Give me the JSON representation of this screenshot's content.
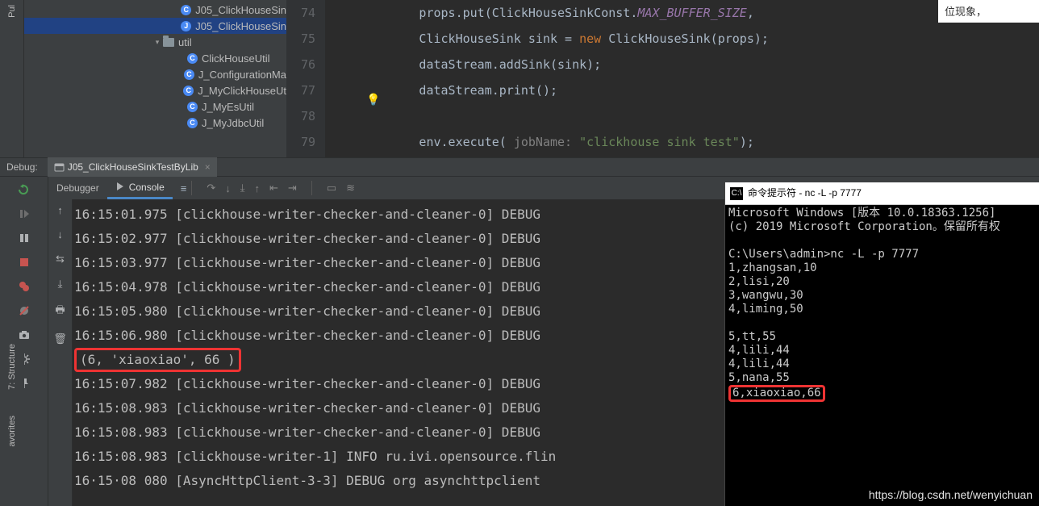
{
  "leftbar": {
    "v1": "Pul"
  },
  "project": {
    "items": [
      {
        "indent": 190,
        "cls": "c",
        "letter": "C",
        "label": "J05_ClickHouseSin",
        "sel": false
      },
      {
        "indent": 190,
        "cls": "j",
        "letter": "J",
        "label": "J05_ClickHouseSin",
        "sel": true
      },
      {
        "indent": 160,
        "folder": true,
        "chev": true,
        "label": "util",
        "sel": false
      },
      {
        "indent": 190,
        "cls": "c",
        "letter": "C",
        "label": "ClickHouseUtil",
        "sel": false
      },
      {
        "indent": 190,
        "cls": "c",
        "letter": "C",
        "label": "J_ConfigurationMa",
        "sel": false
      },
      {
        "indent": 190,
        "cls": "c",
        "letter": "C",
        "label": "J_MyClickHouseUt",
        "sel": false
      },
      {
        "indent": 190,
        "cls": "c",
        "letter": "C",
        "label": "J_MyEsUtil",
        "sel": false
      },
      {
        "indent": 190,
        "cls": "c",
        "letter": "C",
        "label": "J_MyJdbcUtil",
        "sel": false
      }
    ]
  },
  "editor": {
    "lines": [
      {
        "n": "74",
        "html": "props.put(ClickHouseSinkConst.<span class='fld'>MAX_BUFFER_SIZE</span>,"
      },
      {
        "n": "75",
        "html": "ClickHouseSink sink = <span class='kw'>new</span> ClickHouseSink(props);"
      },
      {
        "n": "76",
        "html": "dataStream.addSink(sink);"
      },
      {
        "n": "77",
        "html": "dataStream.print();"
      },
      {
        "n": "78",
        "html": ""
      },
      {
        "n": "79",
        "html": "env.execute( <span class='prm'>jobName:</span> <span class='str'>\"clickhouse sink test\"</span>);"
      }
    ]
  },
  "debug": {
    "label": "Debug:",
    "tab": "J05_ClickHouseSinkTestByLib"
  },
  "tabs": {
    "debugger": "Debugger",
    "console": "Console"
  },
  "consoleLines": [
    "16:15:01.975 [clickhouse-writer-checker-and-cleaner-0] DEBUG ",
    "16:15:02.977 [clickhouse-writer-checker-and-cleaner-0] DEBUG ",
    "16:15:03.977 [clickhouse-writer-checker-and-cleaner-0] DEBUG ",
    "16:15:04.978 [clickhouse-writer-checker-and-cleaner-0] DEBUG ",
    "16:15:05.980 [clickhouse-writer-checker-and-cleaner-0] DEBUG ",
    "16:15:06.980 [clickhouse-writer-checker-and-cleaner-0] DEBUG "
  ],
  "consoleHi": "(6, 'xiaoxiao', 66 )",
  "consoleLines2": [
    "16:15:07.982 [clickhouse-writer-checker-and-cleaner-0] DEBUG ",
    "16:15:08.983 [clickhouse-writer-checker-and-cleaner-0] DEBUG ",
    "16:15:08.983 [clickhouse-writer-checker-and-cleaner-0] DEBUG ",
    "16:15:08.983 [clickhouse-writer-1] INFO ru.ivi.opensource.flin",
    "16·15·08 080 [AsyncHttpClient-3-3] DEBUG org asynchttpclient "
  ],
  "cmd": {
    "title": "命令提示符 - nc  -L  -p  7777",
    "body1": "Microsoft Windows [版本 10.0.18363.1256]\n(c) 2019 Microsoft Corporation。保留所有权\n\nC:\\Users\\admin>nc -L -p 7777\n1,zhangsan,10\n2,lisi,20\n3,wangwu,30\n4,liming,50\n\n5,tt,55\n4,lili,44\n4,lili,44\n5,nana,55",
    "hi": "6,xiaoxiao,66"
  },
  "note": "位现象，",
  "leftbar2": {
    "v1": "7: Structure",
    "v2": "avorites"
  },
  "watermark": "https://blog.csdn.net/wenyichuan"
}
